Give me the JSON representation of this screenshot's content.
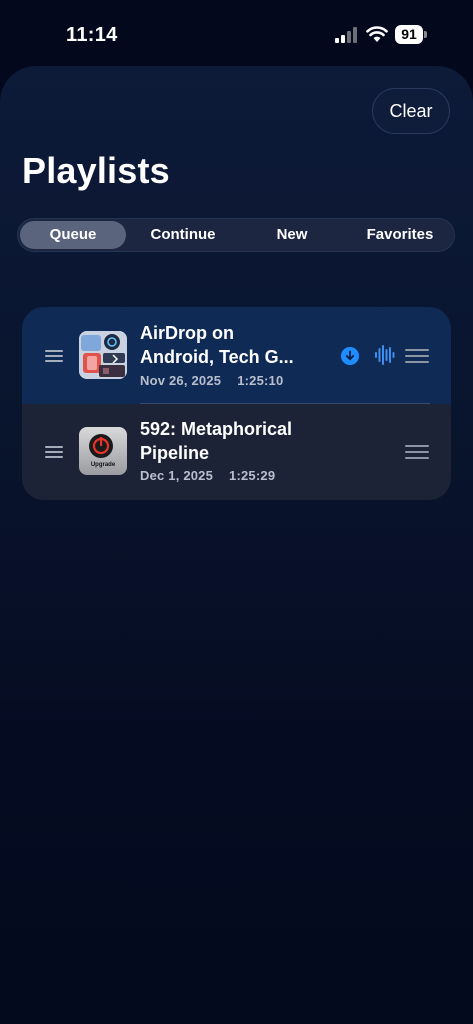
{
  "status_bar": {
    "time": "11:14",
    "battery": "91"
  },
  "header": {
    "title": "Playlists",
    "clear_label": "Clear"
  },
  "tabs": [
    {
      "label": "Queue",
      "selected": true
    },
    {
      "label": "Continue",
      "selected": false
    },
    {
      "label": "New",
      "selected": false
    },
    {
      "label": "Favorites",
      "selected": false
    }
  ],
  "queue": [
    {
      "title_line1": "AirDrop on",
      "title_line2": "Android, Tech G...",
      "date": "Nov 26, 2025",
      "duration": "1:25:10",
      "downloaded": true,
      "playing": true
    },
    {
      "title_line1": "592: Metaphorical",
      "title_line2": "Pipeline",
      "date": "Dec 1, 2025",
      "duration": "1:25:29",
      "art_text": "Upgrade",
      "downloaded": false,
      "playing": false
    }
  ],
  "colors": {
    "accent": "#1f8cff",
    "background": "#03081c",
    "active_row": "#0e2a55",
    "row": "#1c2337"
  },
  "icons": [
    "signal-icon",
    "wifi-icon",
    "battery-icon",
    "drag-handle-icon",
    "download-icon",
    "waveform-icon",
    "reorder-icon"
  ]
}
